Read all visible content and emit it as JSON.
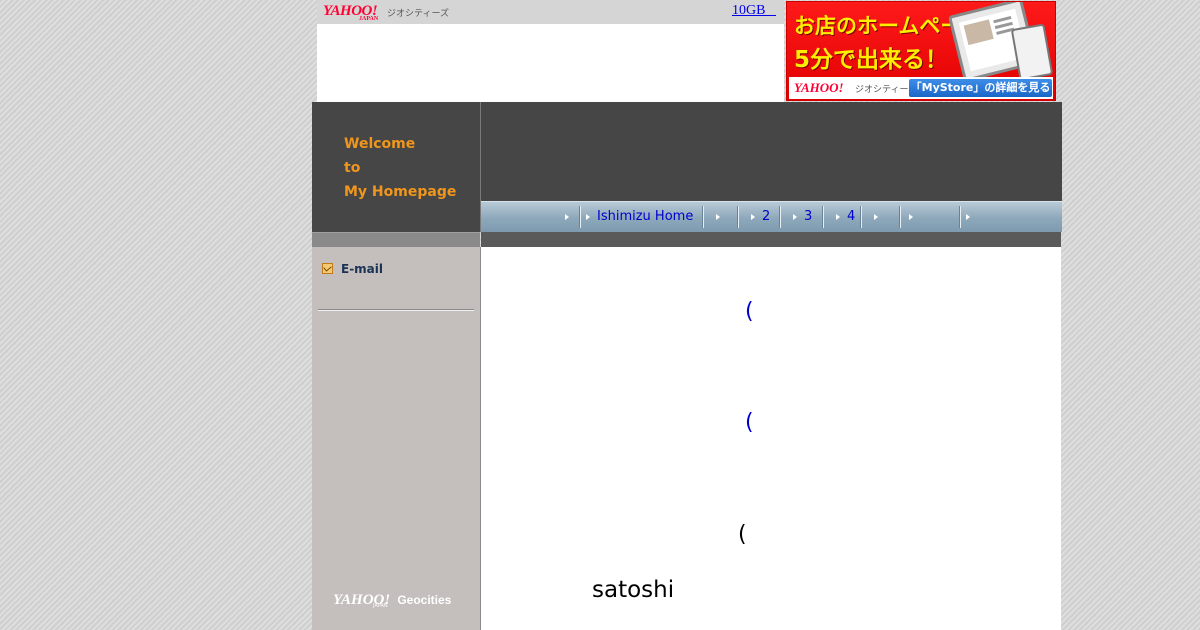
{
  "topbar": {
    "logo_yahoo": "YAHOO!",
    "logo_japan": "JAPAN",
    "logo_service": "ジオシティーズ",
    "storage_link": "10GB   "
  },
  "ad": {
    "line1": "お店のホームページが",
    "line2": "5分で出来る！",
    "logo_yahoo": "YAHOO!",
    "logo_service": "ジオシティーズ",
    "cta": "「MyStore」の詳細を見る",
    "colors": {
      "background": "#e60012",
      "headline": "#ffee00",
      "cta": "#1a66c8"
    }
  },
  "header": {
    "welcome_lines": [
      "Welcome",
      "to",
      "My Homepage"
    ]
  },
  "nav": {
    "items": [
      {
        "label": ""
      },
      {
        "label": "Ishimizu Home"
      },
      {
        "label": ""
      },
      {
        "label": "2"
      },
      {
        "label": "3"
      },
      {
        "label": "4"
      },
      {
        "label": ""
      },
      {
        "label": ""
      },
      {
        "label": ""
      }
    ]
  },
  "sidebar": {
    "email_label": "E-mail",
    "footer_yahoo": "YAHOO!",
    "footer_japan": "JAPAN",
    "footer_geocities": "Geocities"
  },
  "content": {
    "link1": "(",
    "link2": "(",
    "text3": "(",
    "signature": "satoshi"
  },
  "colors": {
    "header_bg": "#464646",
    "welcome_text": "#f0961c",
    "sidebar_bg": "#c4bfbc",
    "link": "#0000cc"
  }
}
